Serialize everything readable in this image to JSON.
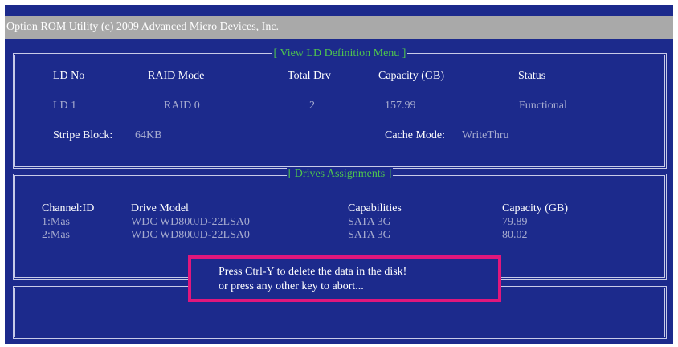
{
  "title_bar": "Option ROM Utility (c) 2009 Advanced Micro Devices, Inc.",
  "ld_menu": {
    "title": "[ View LD Definition Menu ]",
    "headers": [
      "LD  No",
      "RAID Mode",
      "Total Drv",
      "Capacity (GB)",
      "Status"
    ],
    "row": [
      "LD  1",
      "RAID 0",
      "2",
      "157.99",
      "Functional"
    ],
    "stripe_label": "Stripe Block:",
    "stripe_value": "64KB",
    "cache_label": "Cache Mode:",
    "cache_value": "WriteThru"
  },
  "drives": {
    "title": "[ Drives Assignments ]",
    "headers": [
      "Channel:ID",
      "Drive Model",
      "Capabilities",
      "Capacity (GB)"
    ],
    "rows": [
      [
        "1:Mas",
        "WDC WD800JD-22LSA0",
        "SATA 3G",
        "79.89"
      ],
      [
        "2:Mas",
        "WDC WD800JD-22LSA0",
        "SATA 3G",
        "80.02"
      ]
    ]
  },
  "dialog": {
    "line1": "Press Ctrl-Y to delete the data in the disk!",
    "line2": "or press any other key to abort..."
  },
  "colors": {
    "background": "#1c2a8c",
    "title_bar": "#a9a9a9",
    "section_title": "#4ec44e",
    "dialog_border": "#e0177c"
  }
}
